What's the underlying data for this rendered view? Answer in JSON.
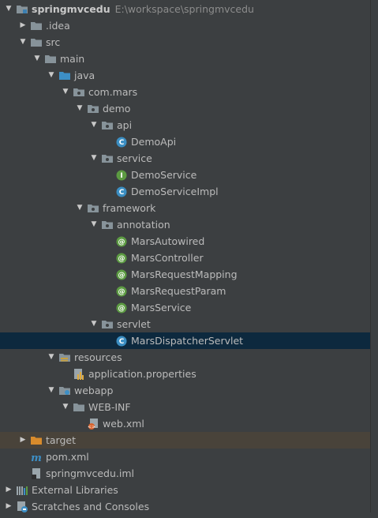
{
  "tree": [
    {
      "label": "springmvcedu",
      "path": "E:\\workspace\\springmvcedu",
      "depth": 0,
      "arrow": "down",
      "icon": "module-folder-icon",
      "bold": true
    },
    {
      "label": ".idea",
      "depth": 1,
      "arrow": "right",
      "icon": "folder-icon"
    },
    {
      "label": "src",
      "depth": 1,
      "arrow": "down",
      "icon": "folder-icon"
    },
    {
      "label": "main",
      "depth": 2,
      "arrow": "down",
      "icon": "folder-icon"
    },
    {
      "label": "java",
      "depth": 3,
      "arrow": "down",
      "icon": "source-folder-icon"
    },
    {
      "label": "com.mars",
      "depth": 4,
      "arrow": "down",
      "icon": "package-icon"
    },
    {
      "label": "demo",
      "depth": 5,
      "arrow": "down",
      "icon": "package-icon"
    },
    {
      "label": "api",
      "depth": 6,
      "arrow": "down",
      "icon": "package-icon"
    },
    {
      "label": "DemoApi",
      "depth": 7,
      "arrow": "none",
      "icon": "class-icon"
    },
    {
      "label": "service",
      "depth": 6,
      "arrow": "down",
      "icon": "package-icon"
    },
    {
      "label": "DemoService",
      "depth": 7,
      "arrow": "none",
      "icon": "interface-icon"
    },
    {
      "label": "DemoServiceImpl",
      "depth": 7,
      "arrow": "none",
      "icon": "class-icon"
    },
    {
      "label": "framework",
      "depth": 5,
      "arrow": "down",
      "icon": "package-icon"
    },
    {
      "label": "annotation",
      "depth": 6,
      "arrow": "down",
      "icon": "package-icon"
    },
    {
      "label": "MarsAutowired",
      "depth": 7,
      "arrow": "none",
      "icon": "annotation-icon"
    },
    {
      "label": "MarsController",
      "depth": 7,
      "arrow": "none",
      "icon": "annotation-icon"
    },
    {
      "label": "MarsRequestMapping",
      "depth": 7,
      "arrow": "none",
      "icon": "annotation-icon"
    },
    {
      "label": "MarsRequestParam",
      "depth": 7,
      "arrow": "none",
      "icon": "annotation-icon"
    },
    {
      "label": "MarsService",
      "depth": 7,
      "arrow": "none",
      "icon": "annotation-icon"
    },
    {
      "label": "servlet",
      "depth": 6,
      "arrow": "down",
      "icon": "package-icon"
    },
    {
      "label": "MarsDispatcherServlet",
      "depth": 7,
      "arrow": "none",
      "icon": "class-icon",
      "selected": true
    },
    {
      "label": "resources",
      "depth": 3,
      "arrow": "down",
      "icon": "resources-folder-icon"
    },
    {
      "label": "application.properties",
      "depth": 4,
      "arrow": "none",
      "icon": "properties-file-icon"
    },
    {
      "label": "webapp",
      "depth": 3,
      "arrow": "down",
      "icon": "web-folder-icon"
    },
    {
      "label": "WEB-INF",
      "depth": 4,
      "arrow": "down",
      "icon": "folder-icon"
    },
    {
      "label": "web.xml",
      "depth": 5,
      "arrow": "none",
      "icon": "xml-file-icon"
    },
    {
      "label": "target",
      "depth": 1,
      "arrow": "right",
      "icon": "excluded-folder-icon",
      "excluded": true
    },
    {
      "label": "pom.xml",
      "depth": 1,
      "arrow": "none",
      "icon": "maven-icon"
    },
    {
      "label": "springmvcedu.iml",
      "depth": 1,
      "arrow": "none",
      "icon": "iml-file-icon"
    },
    {
      "label": "External Libraries",
      "depth": 0,
      "arrow": "right",
      "icon": "libraries-icon"
    },
    {
      "label": "Scratches and Consoles",
      "depth": 0,
      "arrow": "right",
      "icon": "scratches-icon"
    }
  ]
}
